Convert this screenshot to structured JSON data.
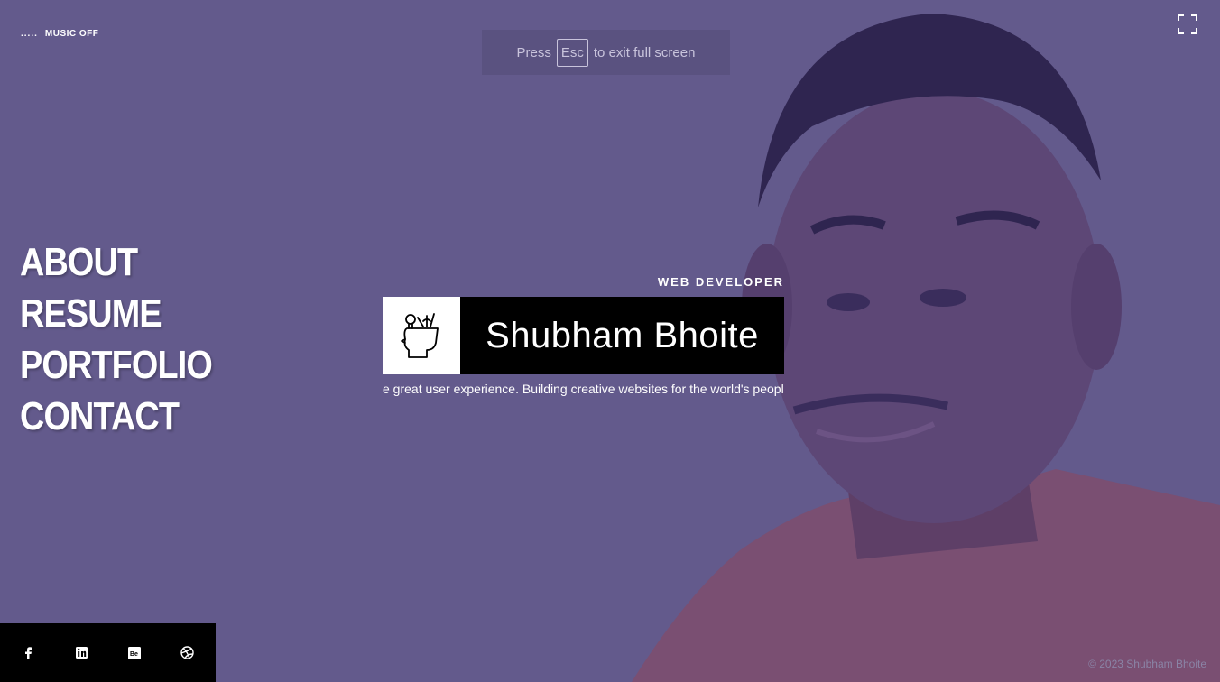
{
  "music": {
    "label": "MUSIC OFF",
    "dots": "....."
  },
  "fullscreen_toast": {
    "prefix": "Press",
    "key": "Esc",
    "suffix": "to exit full screen"
  },
  "nav": {
    "items": [
      {
        "label": "ABOUT"
      },
      {
        "label": "RESUME"
      },
      {
        "label": "PORTFOLIO"
      },
      {
        "label": "CONTACT"
      }
    ]
  },
  "hero": {
    "role": "WEB DEVELOPER",
    "name": "Shubham Bhoite",
    "ticker": "e great user experience. Building creative websites for the world's people. A"
  },
  "social": {
    "icons": [
      "facebook-icon",
      "linkedin-icon",
      "behance-icon",
      "dribbble-icon"
    ]
  },
  "footer": {
    "copyright": "© 2023 Shubham Bhoite"
  },
  "colors": {
    "background": "#635a8c",
    "card": "#000000",
    "accent": "#ffffff"
  }
}
